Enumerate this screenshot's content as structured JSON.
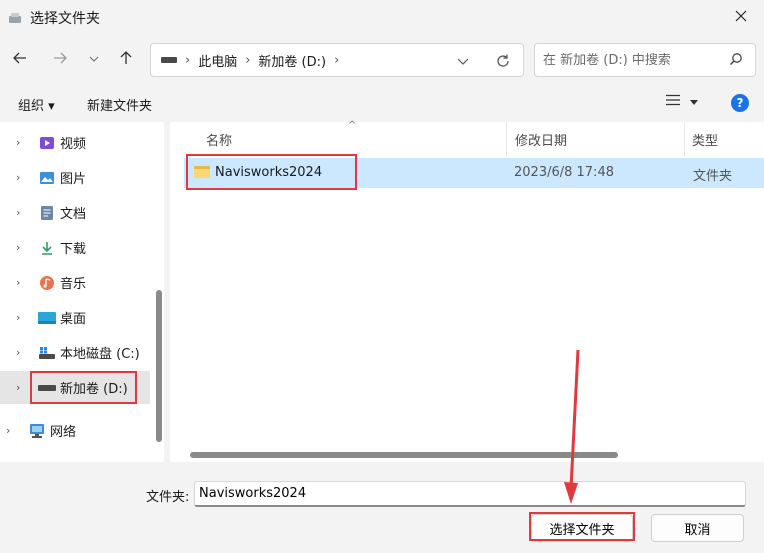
{
  "window": {
    "title": "选择文件夹"
  },
  "address": {
    "crumbs": [
      "此电脑",
      "新加卷 (D:)"
    ],
    "separator": "›"
  },
  "search": {
    "placeholder": "在 新加卷 (D:) 中搜索"
  },
  "toolbar": {
    "organize": "组织 ▾",
    "new_folder": "新建文件夹",
    "help": "?"
  },
  "sidebar": {
    "items": [
      {
        "label": "视频",
        "icon": "video-icon"
      },
      {
        "label": "图片",
        "icon": "pictures-icon"
      },
      {
        "label": "文档",
        "icon": "document-icon"
      },
      {
        "label": "下载",
        "icon": "download-icon"
      },
      {
        "label": "音乐",
        "icon": "music-icon"
      },
      {
        "label": "桌面",
        "icon": "desktop-icon"
      },
      {
        "label": "本地磁盘 (C:)",
        "icon": "drive-icon"
      },
      {
        "label": "新加卷 (D:)",
        "icon": "drive-icon",
        "selected": true
      },
      {
        "label": "网络",
        "icon": "network-icon"
      }
    ]
  },
  "columns": {
    "name": "名称",
    "modified": "修改日期",
    "type": "类型"
  },
  "files": [
    {
      "name": "Navisworks2024",
      "modified": "2023/6/8 17:48",
      "type": "文件夹",
      "selected": true
    }
  ],
  "footer": {
    "folder_label": "文件夹:",
    "folder_value": "Navisworks2024",
    "select_button": "选择文件夹",
    "cancel_button": "取消"
  },
  "colors": {
    "accent": "#1a73e8",
    "selection": "#cce8ff",
    "highlight_box": "#e0393e"
  }
}
